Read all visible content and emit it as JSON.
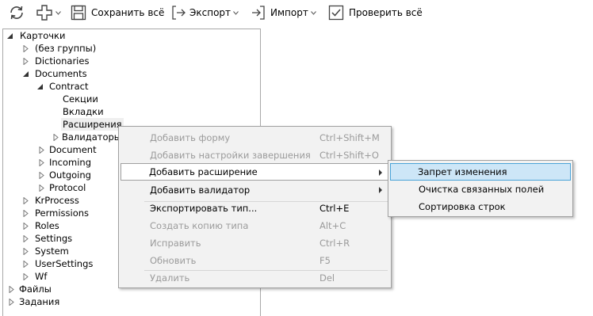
{
  "toolbar": {
    "refresh_icon": "refresh-icon",
    "add_icon": "plus-icon",
    "save_all": "Сохранить всё",
    "export": "Экспорт",
    "import": "Импорт",
    "check_all": "Проверить всё"
  },
  "tree": {
    "root": "Карточки",
    "no_group": "(без группы)",
    "dictionaries": "Dictionaries",
    "documents": "Documents",
    "contract": "Contract",
    "sections": "Секции",
    "tabs": "Вкладки",
    "extensions": "Расширения",
    "validators": "Валидаторы",
    "document": "Document",
    "incoming": "Incoming",
    "outgoing": "Outgoing",
    "protocol": "Protocol",
    "krprocess": "KrProcess",
    "permissions": "Permissions",
    "roles": "Roles",
    "settings": "Settings",
    "system": "System",
    "usersettings": "UserSettings",
    "wf": "Wf",
    "files": "Файлы",
    "tasks": "Задания"
  },
  "context_menu": {
    "add_form": "Добавить форму",
    "add_form_key": "Ctrl+Shift+M",
    "add_completion": "Добавить настройки завершения",
    "add_completion_key": "Ctrl+Shift+O",
    "add_extension": "Добавить расширение",
    "add_validator": "Добавить валидатор",
    "export_type": "Экспортировать тип...",
    "export_type_key": "Ctrl+E",
    "create_copy": "Создать копию типа",
    "create_copy_key": "Alt+C",
    "fix": "Исправить",
    "fix_key": "Ctrl+R",
    "refresh": "Обновить",
    "refresh_key": "F5",
    "delete": "Удалить",
    "delete_key": "Del"
  },
  "submenu": {
    "item1": "Запрет изменения",
    "item2": "Очистка связанных полей",
    "item3": "Сортировка строк"
  }
}
